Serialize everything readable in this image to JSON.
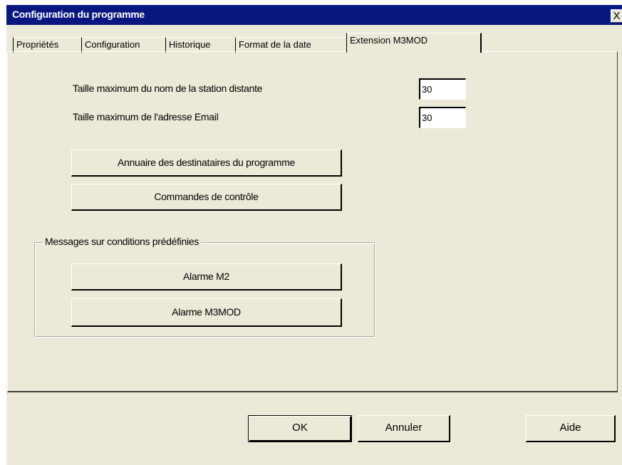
{
  "window": {
    "title": "Configuration du programme",
    "close_label": "X"
  },
  "tabs": [
    {
      "label": "Propriétés"
    },
    {
      "label": "Configuration"
    },
    {
      "label": "Historique"
    },
    {
      "label": "Format de la date"
    },
    {
      "label": "Extension M3MOD"
    }
  ],
  "fields": {
    "station_name_label": "Taille maximum du nom de la station distante",
    "station_name_value": "30",
    "email_label": "Taille maximum de l'adresse Email",
    "email_value": "30"
  },
  "buttons": {
    "directory": "Annuaire des destinataires du programme",
    "control_commands": "Commandes de contrôle"
  },
  "group": {
    "legend": "Messages sur conditions prédéfinies",
    "alarm_m2": "Alarme M2",
    "alarm_m3mod": "Alarme M3MOD"
  },
  "footer": {
    "ok": "OK",
    "cancel": "Annuler",
    "help": "Aide"
  }
}
